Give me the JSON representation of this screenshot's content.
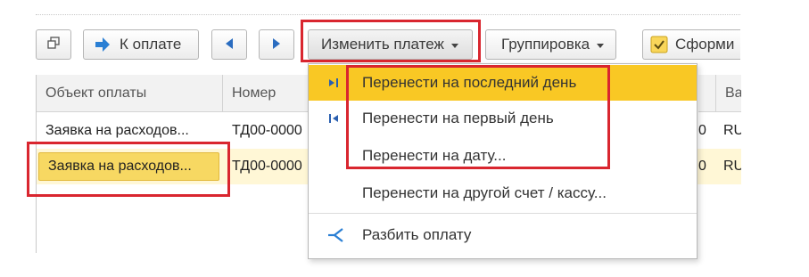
{
  "toolbar": {
    "k_oplate_label": "К оплате",
    "izmenit_label": "Изменить платеж",
    "gruppirovka_label": "Группировка",
    "sformirovat_label": "Сформи"
  },
  "table": {
    "columns": [
      "Объект оплаты",
      "Номер",
      "Ва"
    ],
    "rows": [
      {
        "object": "Заявка на расходов...",
        "number": "ТД00-0000",
        "tail_a": "0",
        "currency": "RU"
      },
      {
        "object": "Заявка на расходов...",
        "number": "ТД00-0000",
        "tail_a": "0",
        "currency": "RU"
      }
    ]
  },
  "menu": {
    "items": [
      {
        "label": "Перенести на последний день",
        "icon": "jump-to-last-icon"
      },
      {
        "label": "Перенести на первый день",
        "icon": "jump-to-first-icon"
      },
      {
        "label": "Перенести на дату..."
      },
      {
        "label": "Перенести на другой счет / кассу..."
      },
      {
        "label": "Разбить оплату",
        "icon": "split-icon"
      }
    ]
  },
  "colors": {
    "highlight": "#f9c824",
    "selected_row": "#fff7d6",
    "selected_cell": "#f7d862",
    "annotation_red": "#d9262f",
    "arrow_blue": "#2a7fd4"
  }
}
